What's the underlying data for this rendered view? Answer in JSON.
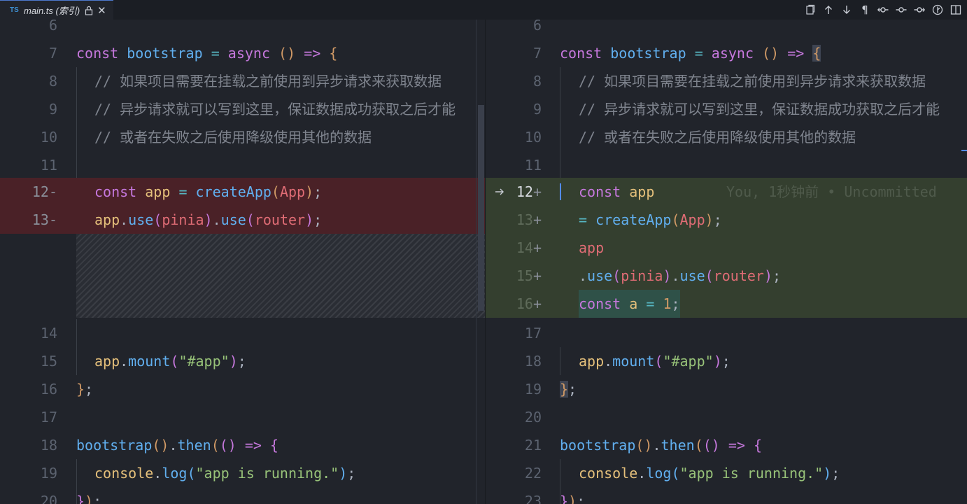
{
  "tab": {
    "lang_badge": "TS",
    "label": "main.ts (索引)"
  },
  "toolbar_icons": [
    "open-file-icon",
    "arrow-up-icon",
    "arrow-down-icon",
    "pilcrow-icon",
    "commit-prev-icon",
    "commit-icon",
    "commit-next-icon",
    "timeline-icon",
    "split-editor-icon"
  ],
  "left": {
    "lines": [
      {
        "n": "6"
      },
      {
        "n": "7",
        "code": "const bootstrap = async () => {"
      },
      {
        "n": "8",
        "code": "// 如果项目需要在挂载之前使用到异步请求来获取数据"
      },
      {
        "n": "9",
        "code": "// 异步请求就可以写到这里，保证数据成功获取之后才能"
      },
      {
        "n": "10",
        "code": "// 或者在失败之后使用降级使用其他的数据"
      },
      {
        "n": "11"
      },
      {
        "n": "12",
        "mark": "-",
        "code": "const app = createApp(App);"
      },
      {
        "n": "13",
        "mark": "-",
        "code": "app.use(pinia).use(router);"
      },
      {
        "n": "14"
      },
      {
        "n": "15",
        "code": "app.mount(\"#app\");"
      },
      {
        "n": "16",
        "code": "};"
      },
      {
        "n": "17"
      },
      {
        "n": "18",
        "code": "bootstrap().then(() => {"
      },
      {
        "n": "19",
        "code": "console.log(\"app is running.\");"
      },
      {
        "n": "20",
        "code": "});"
      }
    ]
  },
  "right": {
    "blame": "You, 1秒钟前 • Uncommitted",
    "lines": [
      {
        "n": "6"
      },
      {
        "n": "7"
      },
      {
        "n": "8"
      },
      {
        "n": "9"
      },
      {
        "n": "10"
      },
      {
        "n": "11"
      },
      {
        "n": "12",
        "mark": "+"
      },
      {
        "n": "13",
        "mark": "+"
      },
      {
        "n": "14",
        "mark": "+"
      },
      {
        "n": "15",
        "mark": "+"
      },
      {
        "n": "16",
        "mark": "+"
      },
      {
        "n": "17"
      },
      {
        "n": "18"
      },
      {
        "n": "19"
      },
      {
        "n": "20"
      },
      {
        "n": "21"
      },
      {
        "n": "22"
      },
      {
        "n": "23"
      }
    ]
  },
  "tokens": {
    "const": "const",
    "bootstrap": "bootstrap",
    "async": "async",
    "app": "app",
    "createApp": "createApp",
    "App": "App",
    "use": "use",
    "pinia": "pinia",
    "router": "router",
    "mount": "mount",
    "app_str": "\"#app\"",
    "then": "then",
    "console": "console",
    "log": "log",
    "running_str": "\"app is running.\"",
    "a": "a",
    "one": "1",
    "c8": "// 如果项目需要在挂载之前使用到异步请求来获取数据",
    "c9": "// 异步请求就可以写到这里，保证数据成功获取之后才能",
    "c10": "// 或者在失败之后使用降级使用其他的数据"
  }
}
